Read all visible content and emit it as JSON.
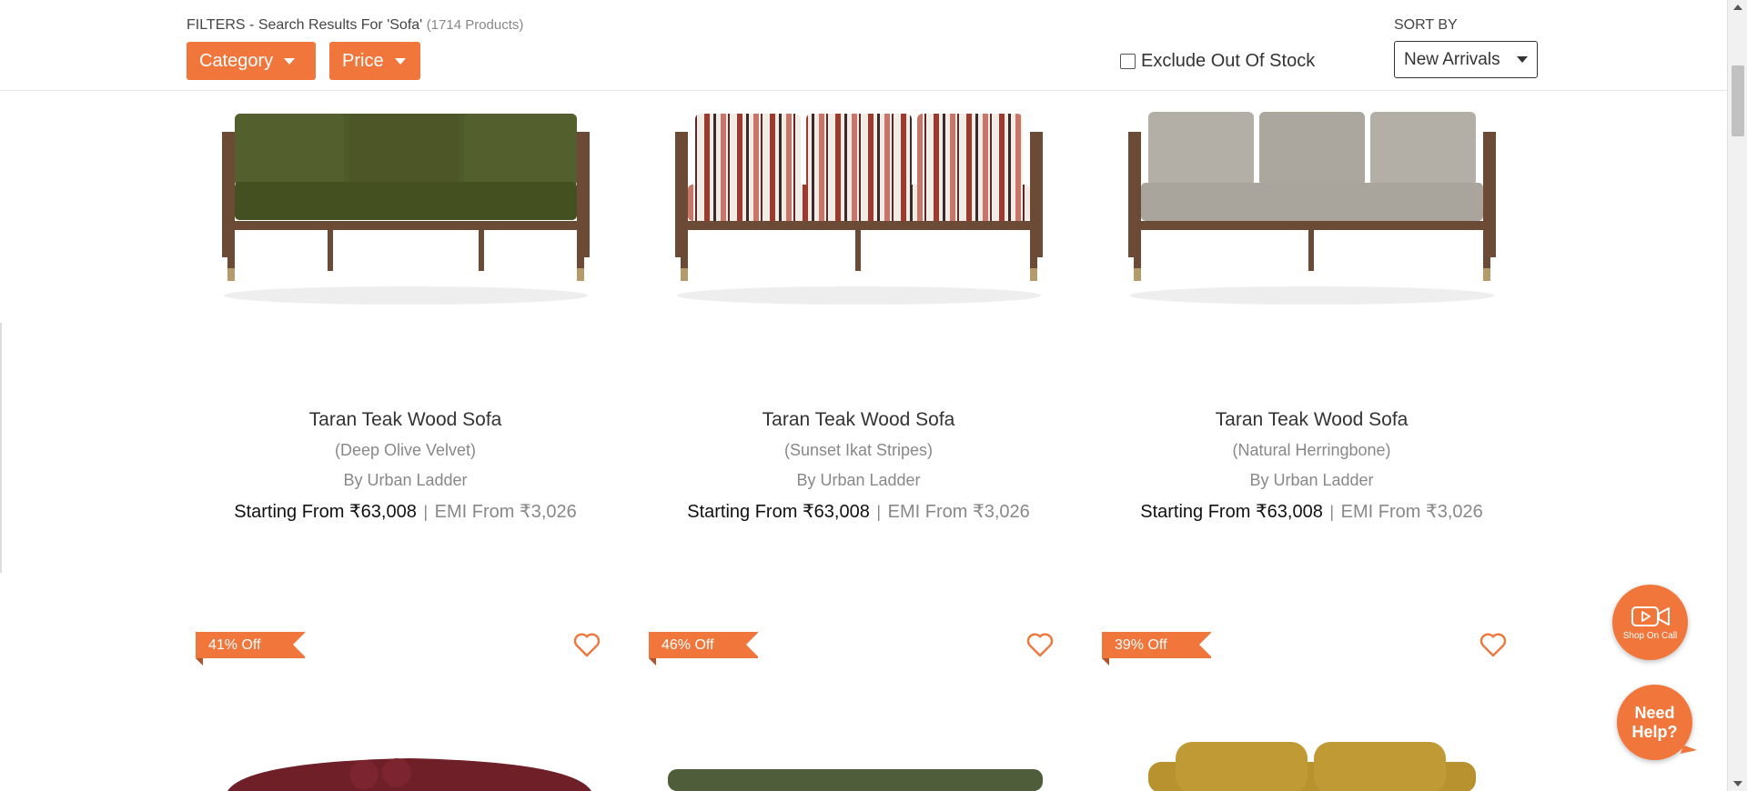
{
  "filters": {
    "title": "FILTERS - Search Results For 'Sofa'",
    "count": "(1714 Products)",
    "category_label": "Category",
    "price_label": "Price",
    "exclude_label": "Exclude Out Of Stock"
  },
  "sort": {
    "label": "SORT BY",
    "value": "New Arrivals"
  },
  "products": [
    {
      "name": "Taran Teak Wood Sofa",
      "variant": "(Deep Olive Velvet)",
      "brand": "By Urban Ladder",
      "price_prefix": "Starting From ",
      "price": "₹63,008",
      "emi": "EMI From ₹3,026"
    },
    {
      "name": "Taran Teak Wood Sofa",
      "variant": "(Sunset Ikat Stripes)",
      "brand": "By Urban Ladder",
      "price_prefix": "Starting From ",
      "price": "₹63,008",
      "emi": "EMI From ₹3,026"
    },
    {
      "name": "Taran Teak Wood Sofa",
      "variant": "(Natural Herringbone)",
      "brand": "By Urban Ladder",
      "price_prefix": "Starting From ",
      "price": "₹63,008",
      "emi": "EMI From ₹3,026"
    }
  ],
  "next_row": [
    {
      "discount": "41% Off"
    },
    {
      "discount": "46% Off"
    },
    {
      "discount": "39% Off"
    }
  ],
  "floating": {
    "shop_on_call": "Shop On Call",
    "need_help": "Need Help?"
  },
  "colors": {
    "accent": "#f0763b"
  },
  "icons": {
    "wishlist": "heart-icon",
    "video_call": "video-camera-icon",
    "dropdown": "caret-down-icon"
  }
}
